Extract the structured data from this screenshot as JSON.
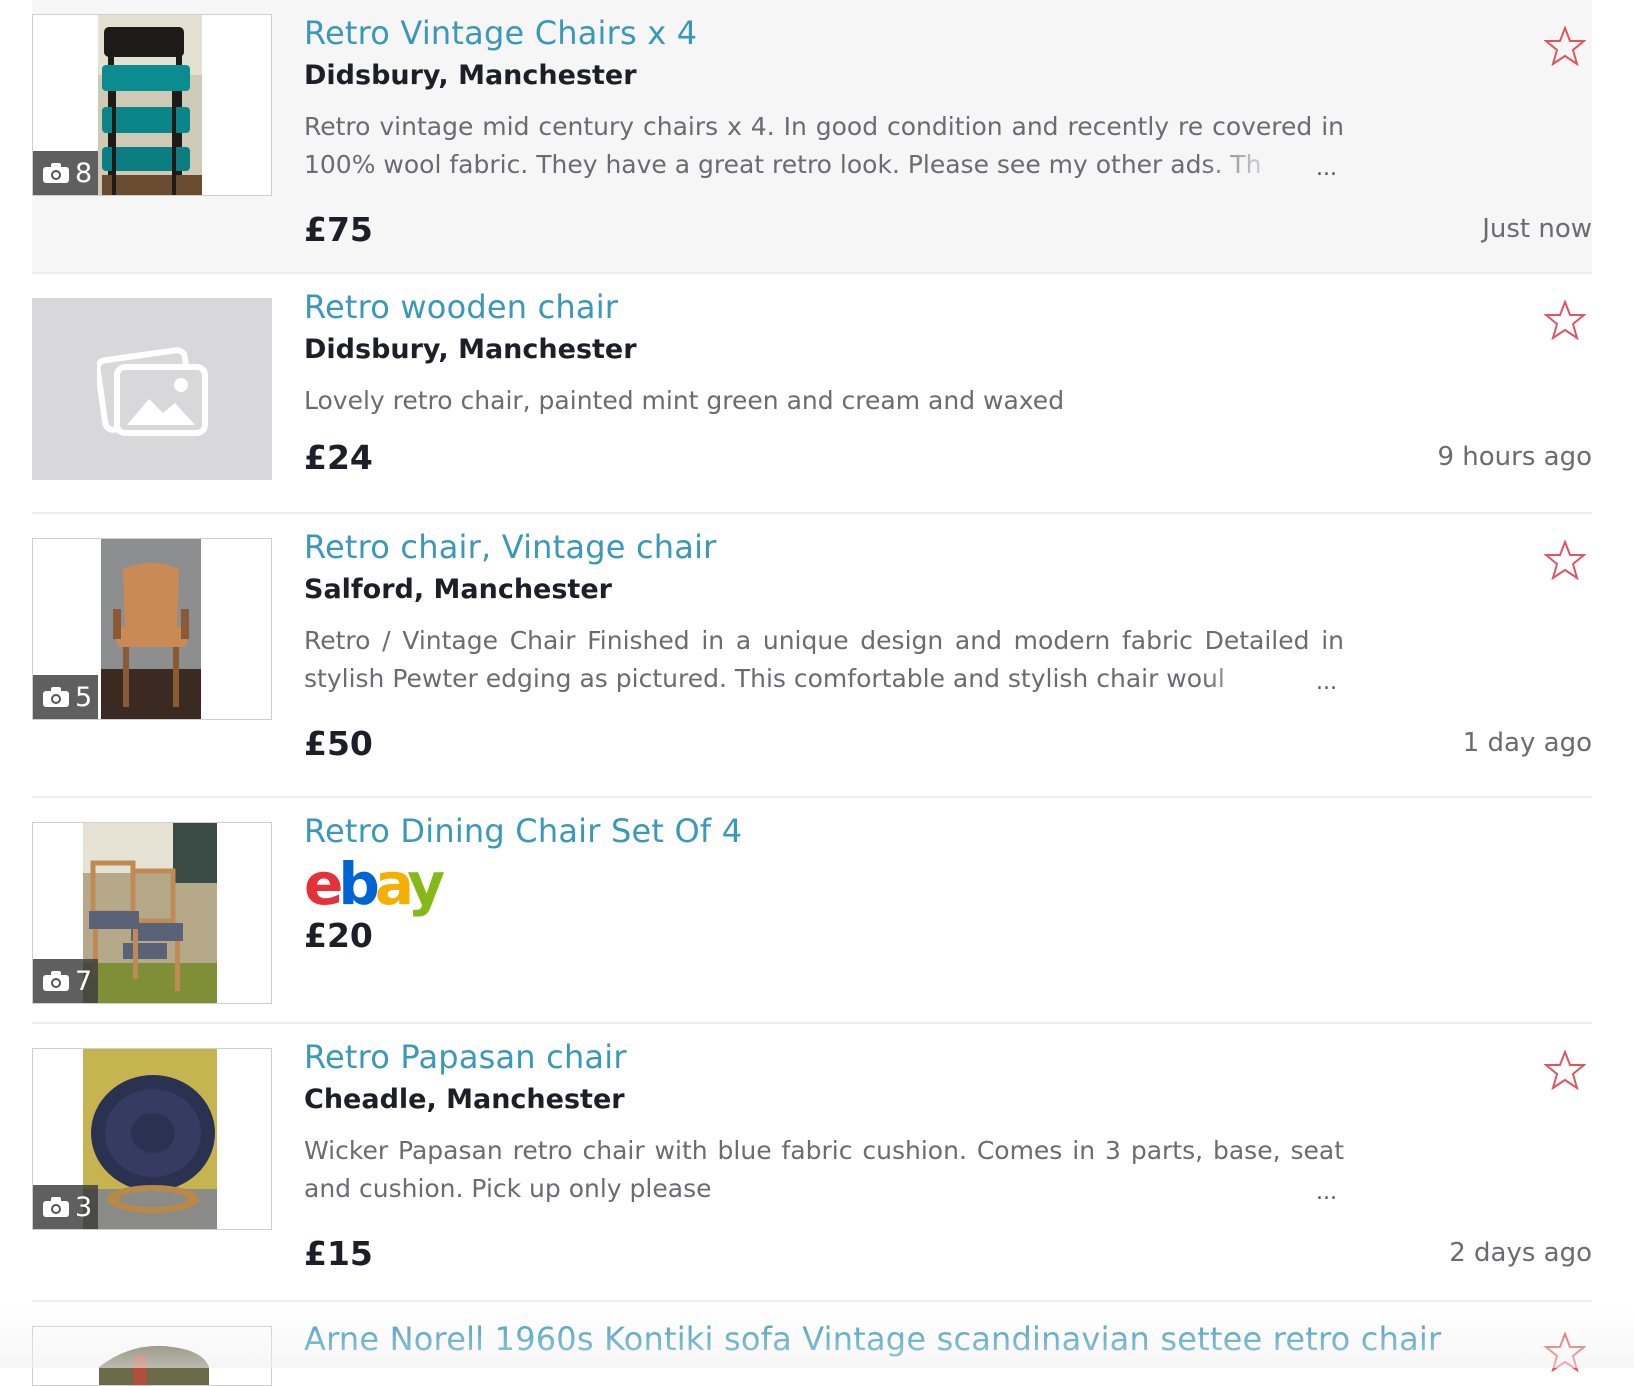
{
  "listings": [
    {
      "title": "Retro Vintage Chairs x 4",
      "location": "Didsbury, Manchester",
      "description": "Retro vintage mid century chairs x 4. In good condition and recently re covered in 100% wool fabric. They have a great retro look. Please see my other ads. Th",
      "ellipsis": "...",
      "price": "£75",
      "time": "Just now",
      "photo_count": "8",
      "favorite_icon": "star-outline-icon"
    },
    {
      "title": "Retro wooden chair",
      "location": "Didsbury, Manchester",
      "description": "Lovely retro chair, painted mint green and cream and waxed",
      "price": "£24",
      "time": "9 hours ago",
      "image_placeholder_icon": "image-placeholder-icon",
      "favorite_icon": "star-outline-icon"
    },
    {
      "title": "Retro chair, Vintage chair",
      "location": "Salford, Manchester",
      "description": "Retro / Vintage Chair  Finished in a unique design and modern fabric  Detailed in stylish  Pewter edging as pictured.  This comfortable and stylish chair woul",
      "ellipsis": "...",
      "price": "£50",
      "time": "1 day ago",
      "photo_count": "5",
      "favorite_icon": "star-outline-icon"
    },
    {
      "title": "Retro Dining Chair Set Of 4",
      "source_logo": "ebay",
      "price": "£20",
      "photo_count": "7"
    },
    {
      "title": "Retro Papasan chair",
      "location": "Cheadle, Manchester",
      "description": "Wicker Papasan retro chair with blue fabric cushion. Comes in 3 parts, base, seat and cushion. Pick up only please",
      "ellipsis": "...",
      "price": "£15",
      "time": "2 days ago",
      "photo_count": "3",
      "favorite_icon": "star-outline-icon"
    },
    {
      "title": "Arne Norell 1960s Kontiki sofa Vintage scandinavian settee retro chair",
      "favorite_icon": "star-outline-icon"
    }
  ],
  "colors": {
    "title_link": "#3a98b9",
    "star_outline": "#e0555f",
    "featured_background": "#f6f6f7",
    "ebay_e": "#e53238",
    "ebay_b": "#0064d2",
    "ebay_a": "#f5af02",
    "ebay_y": "#86b817"
  }
}
